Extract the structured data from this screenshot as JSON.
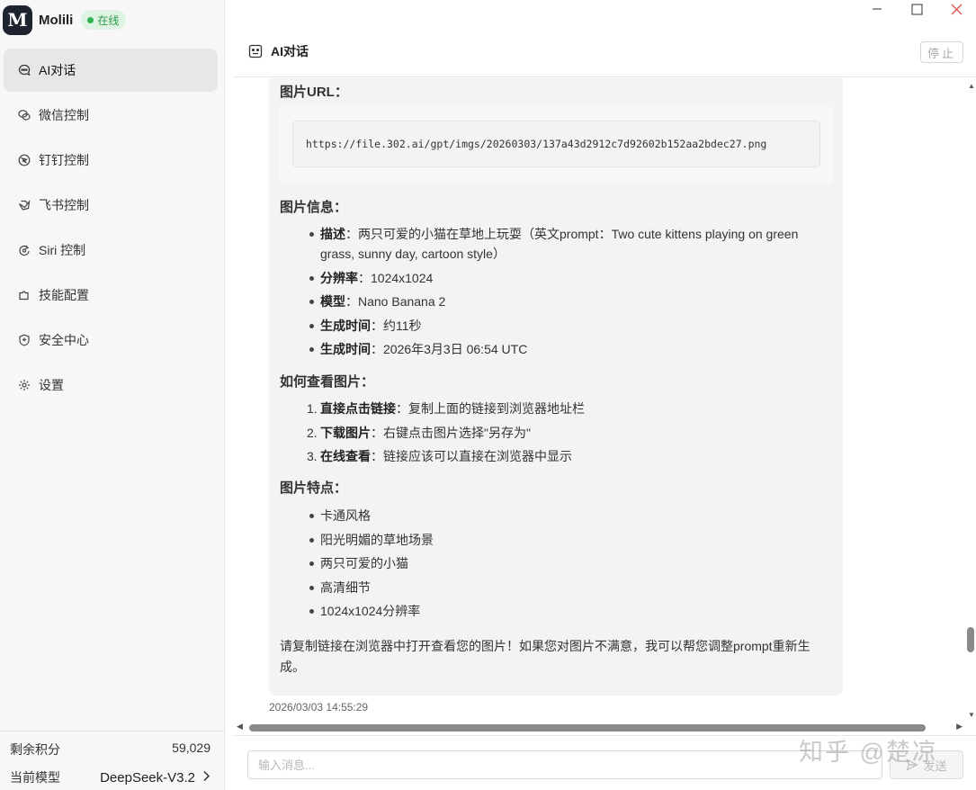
{
  "app": {
    "name": "Molili",
    "logo_glyph": "M",
    "status": "在线",
    "status_color": "#2fb34f"
  },
  "sidebar": {
    "items": [
      {
        "label": "AI对话",
        "icon": "chat-bubble-icon",
        "active": true
      },
      {
        "label": "微信控制",
        "icon": "wechat-icon"
      },
      {
        "label": "钉钉控制",
        "icon": "dingtalk-icon"
      },
      {
        "label": "飞书控制",
        "icon": "feishu-icon"
      },
      {
        "label": "Siri 控制",
        "icon": "siri-icon"
      },
      {
        "label": "技能配置",
        "icon": "puzzle-icon"
      },
      {
        "label": "安全中心",
        "icon": "shield-icon"
      },
      {
        "label": "设置",
        "icon": "gear-icon"
      }
    ],
    "footer": {
      "credits_label": "剩余积分",
      "credits_value": "59,029",
      "model_label": "当前模型",
      "model_value": "DeepSeek-V3.2"
    }
  },
  "header": {
    "title": "AI对话",
    "stop_label": "停止"
  },
  "message": {
    "url_title": "图片URL：",
    "url": "https://file.302.ai/gpt/imgs/20260303/137a43d2912c7d92602b152aa2bdec27.png",
    "info_title": "图片信息：",
    "info": [
      {
        "key": "描述",
        "value": "：两只可爱的小猫在草地上玩耍（英文prompt：Two cute kittens playing on green grass, sunny day, cartoon style）"
      },
      {
        "key": "分辨率",
        "value": "：1024x1024"
      },
      {
        "key": "模型",
        "value": "：Nano Banana 2"
      },
      {
        "key": "生成时间",
        "value": "：约11秒"
      },
      {
        "key": "生成时间",
        "value": "：2026年3月3日 06:54 UTC"
      }
    ],
    "howto_title": "如何查看图片：",
    "steps": [
      {
        "num": "1.",
        "key": "直接点击链接",
        "value": "：复制上面的链接到浏览器地址栏"
      },
      {
        "num": "2.",
        "key": "下载图片",
        "value": "：右键点击图片选择\"另存为\""
      },
      {
        "num": "3.",
        "key": "在线查看",
        "value": "：链接应该可以直接在浏览器中显示"
      }
    ],
    "features_title": "图片特点：",
    "features": [
      "卡通风格",
      "阳光明媚的草地场景",
      "两只可爱的小猫",
      "高清细节",
      "1024x1024分辨率"
    ],
    "closing": "请复制链接在浏览器中打开查看您的图片！如果您对图片不满意，我可以帮您调整prompt重新生成。",
    "timestamp": "2026/03/03 14:55:29"
  },
  "input": {
    "placeholder": "输入消息...",
    "send_label": "发送"
  },
  "watermark": "知乎 @楚凉"
}
